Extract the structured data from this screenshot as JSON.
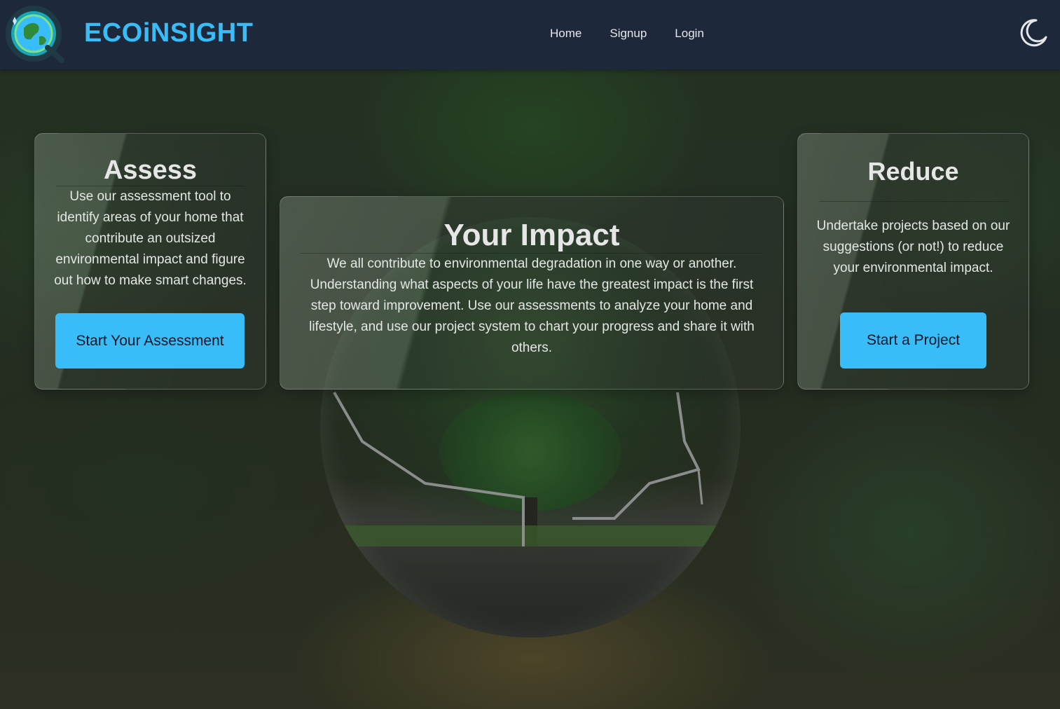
{
  "brand": {
    "name": "ECOiNSIGHT",
    "logo_icon": "globe-magnifier-icon"
  },
  "nav": {
    "links": [
      {
        "label": "Home"
      },
      {
        "label": "Signup"
      },
      {
        "label": "Login"
      }
    ]
  },
  "theme_toggle": {
    "icon": "moon-icon"
  },
  "colors": {
    "navbar": "#1d293b",
    "accent": "#38bdf8"
  },
  "cards": {
    "assess": {
      "title": "Assess",
      "text": "Use our assessment tool to identify areas of your home that contribute an outsized environmental impact and figure out how to make smart changes.",
      "button": "Start Your Assessment"
    },
    "impact": {
      "title": "Your Impact",
      "text": "We all contribute to environmental degradation in one way or another. Understanding what aspects of your life have the greatest impact is the first step toward improvement. Use our assessments to analyze your home and lifestyle, and use our project system to chart your progress and share it with others."
    },
    "reduce": {
      "title": "Reduce",
      "text": "Undertake projects based on our suggestions (or not!) to reduce your environmental impact.",
      "button": "Start a Project"
    }
  }
}
